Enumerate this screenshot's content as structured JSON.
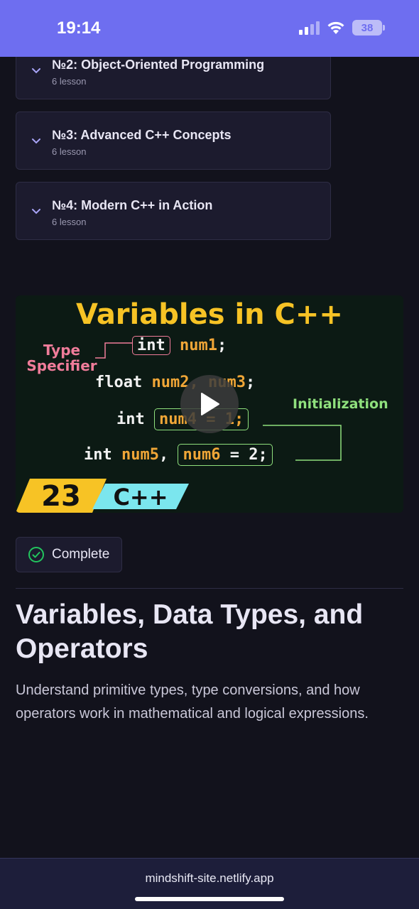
{
  "status_bar": {
    "time": "19:14",
    "battery": "38"
  },
  "modules": [
    {
      "title": "№2: Object-Oriented Programming",
      "subtitle": "6 lesson"
    },
    {
      "title": "№3: Advanced C++ Concepts",
      "subtitle": "6 lesson"
    },
    {
      "title": "№4: Modern C++ in Action",
      "subtitle": "6 lesson"
    }
  ],
  "video": {
    "thumbnail": {
      "title": "Variables in C++",
      "type_specifier_label": "Type Specifier",
      "initialization_label": "Initialization",
      "line1_kw": "int",
      "line1_var": "num1",
      "line1_end": ";",
      "line2_kw": "float",
      "line2_rest": "num2, num3",
      "line2_end": ";",
      "line3_kw": "int",
      "line3_box": "num4 = 1;",
      "line4_kw": "int",
      "line4_var": "num5",
      "line4_sep": ",",
      "line4_box_var": "num6",
      "line4_box_rest": " = 2;",
      "badge_number": "23",
      "badge_lang": "C++"
    },
    "play_icon": "play-icon"
  },
  "complete_button": {
    "label": "Complete",
    "icon": "check-circle-icon",
    "icon_color": "#22c55e"
  },
  "lesson": {
    "title": "Variables, Data Types, and Operators",
    "description": "Understand primitive types, type conversions, and how operators work in mathematical and logical expressions."
  },
  "browser": {
    "url": "mindshift-site.netlify.app"
  },
  "colors": {
    "status_bar": "#6e6ef0",
    "background": "#12121c",
    "card": "#1c1b2e",
    "accent": "#a7a3f5"
  }
}
